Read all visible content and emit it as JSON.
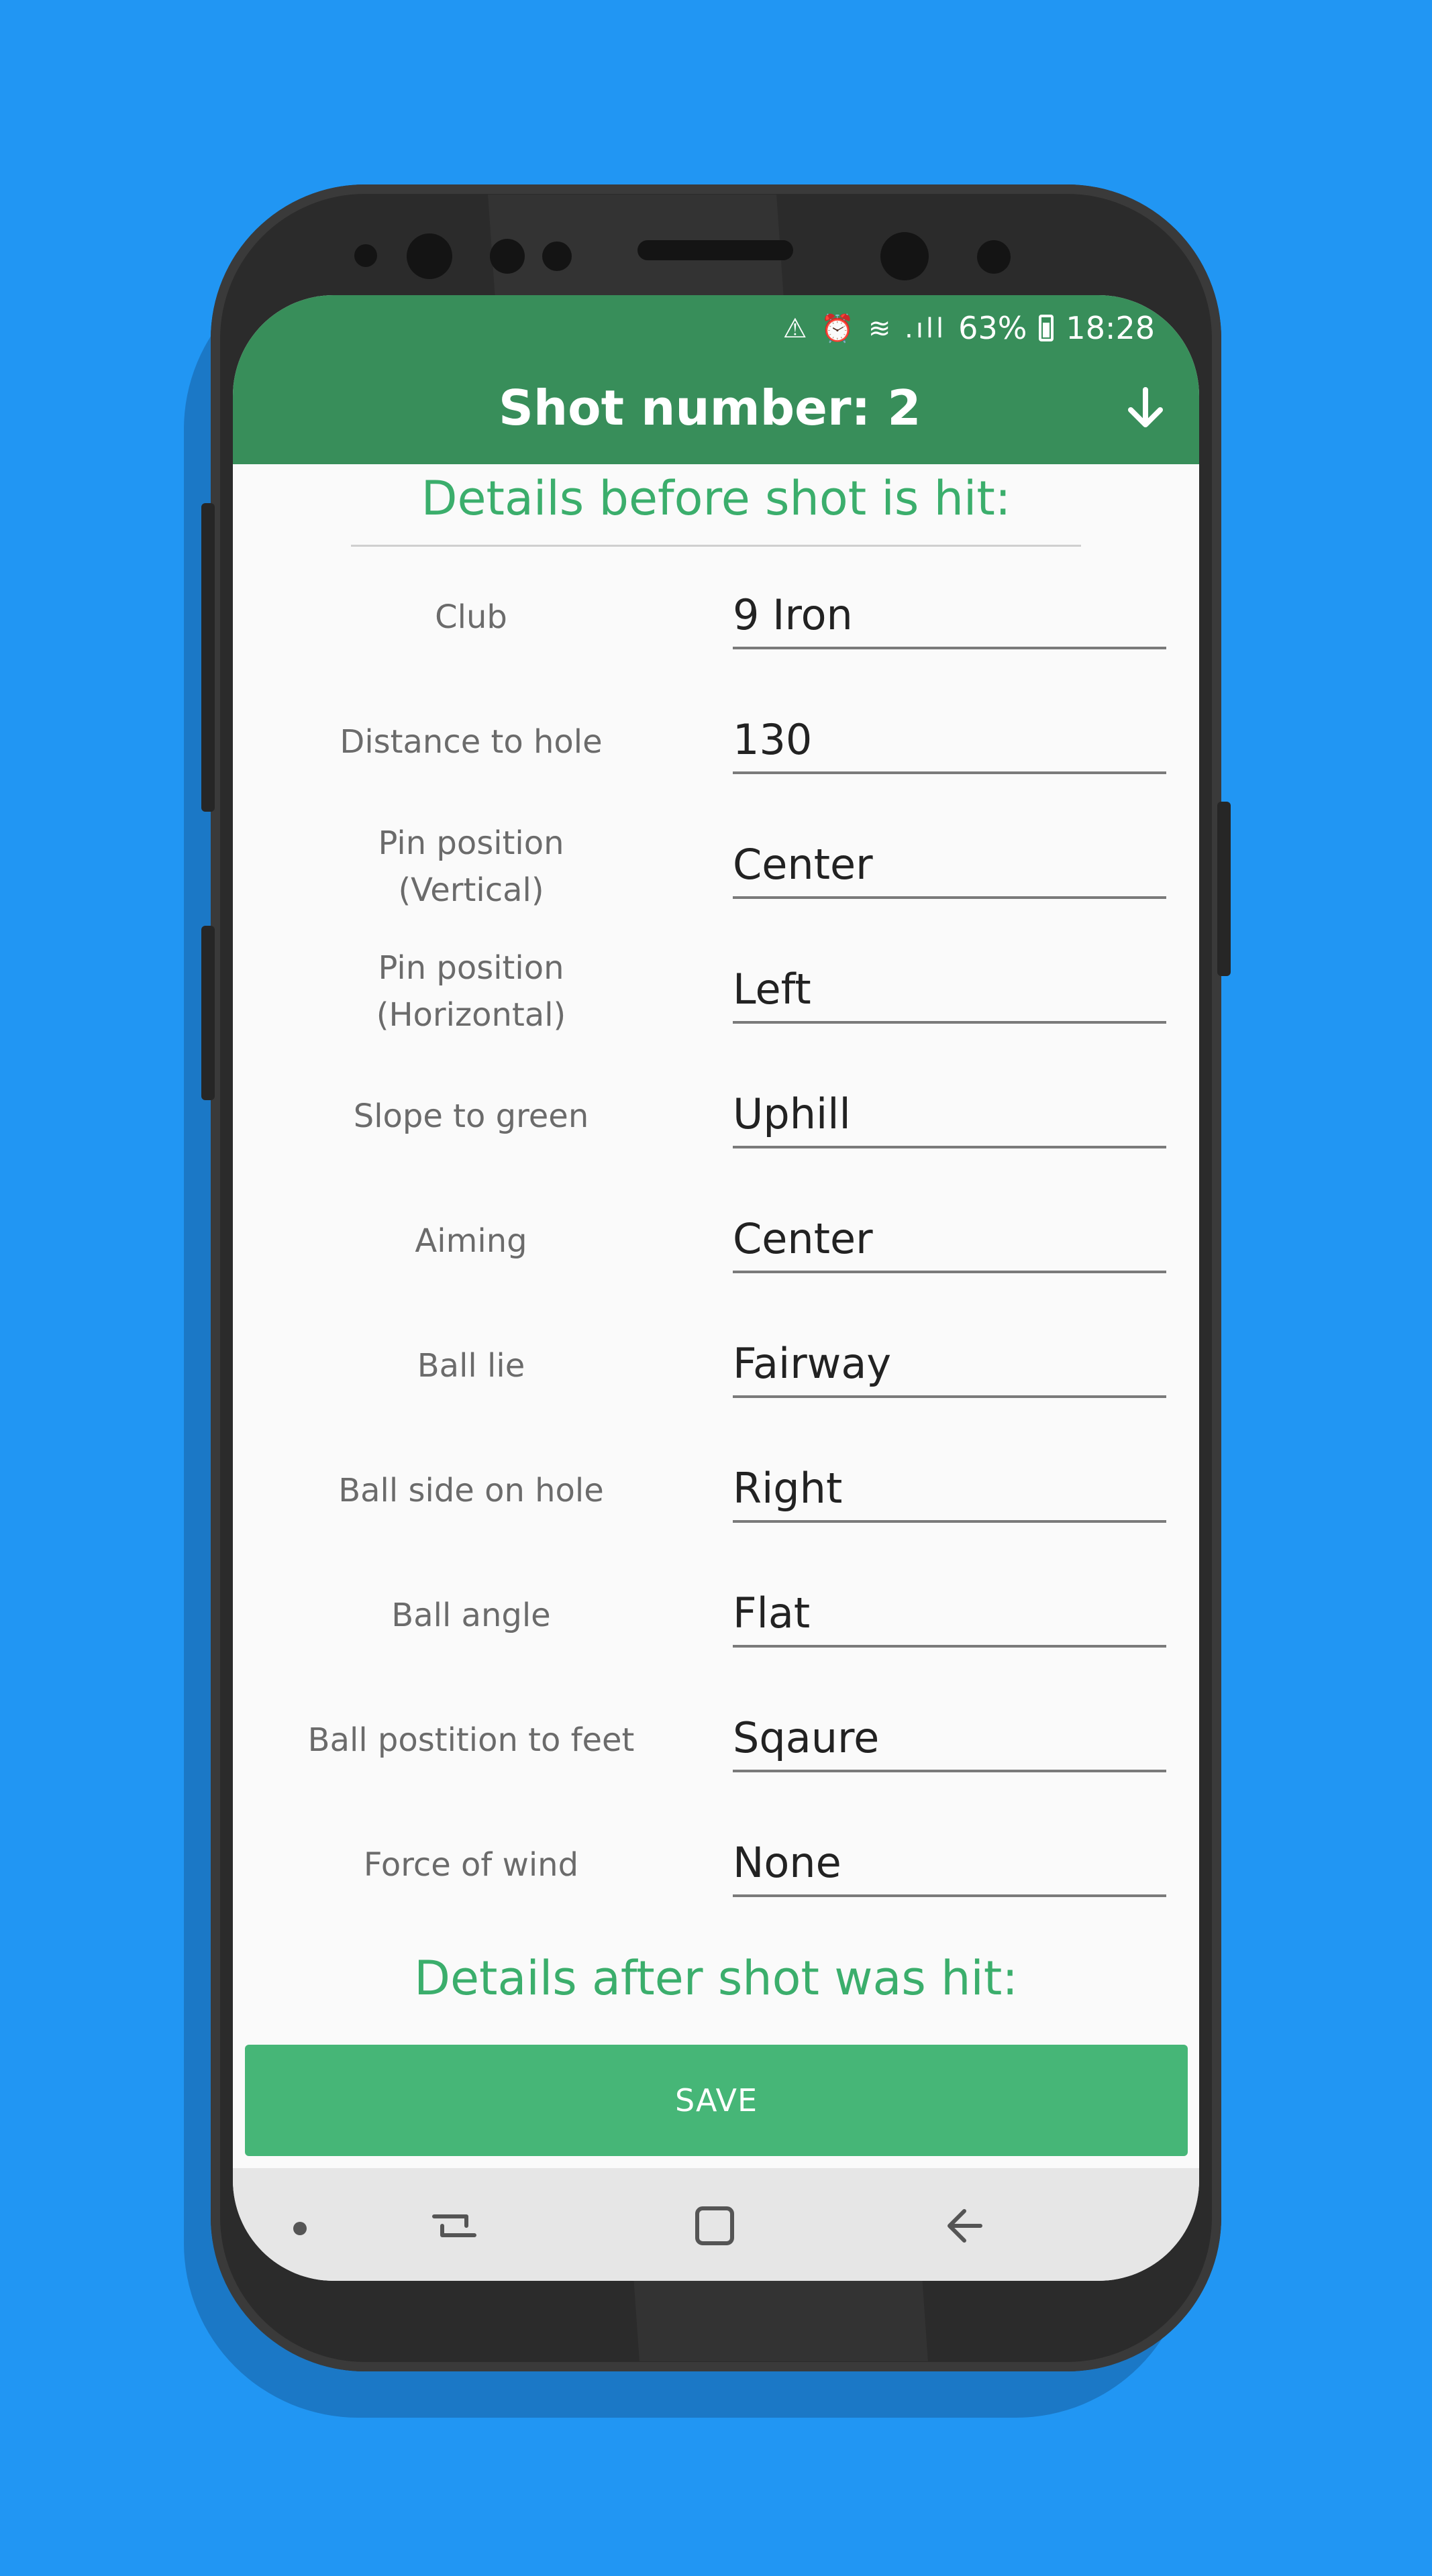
{
  "status_bar": {
    "icons": "⚠ ⏰ ≋ .ıll",
    "battery": "63%",
    "time": "18:28"
  },
  "app_bar": {
    "title": "Shot number: 2",
    "collapse_icon": "arrow-down-icon"
  },
  "sections": {
    "before": "Details before shot is hit:",
    "after": "Details after shot was hit:"
  },
  "fields": [
    {
      "label": "Club",
      "value": "9 Iron"
    },
    {
      "label": "Distance to hole",
      "value": "130"
    },
    {
      "label": "Pin position\n(Vertical)",
      "value": "Center"
    },
    {
      "label": "Pin position\n(Horizontal)",
      "value": "Left"
    },
    {
      "label": "Slope to green",
      "value": "Uphill"
    },
    {
      "label": "Aiming",
      "value": "Center"
    },
    {
      "label": "Ball lie",
      "value": "Fairway"
    },
    {
      "label": "Ball side on hole",
      "value": "Right"
    },
    {
      "label": "Ball angle",
      "value": "Flat"
    },
    {
      "label": "Ball postition to feet",
      "value": "Sqaure"
    },
    {
      "label": "Force of wind",
      "value": "None"
    }
  ],
  "save_button": "SAVE",
  "colors": {
    "background": "#2196F3",
    "app_bar": "#388E5A",
    "accent": "#3BAE6C",
    "button": "#46B677"
  }
}
